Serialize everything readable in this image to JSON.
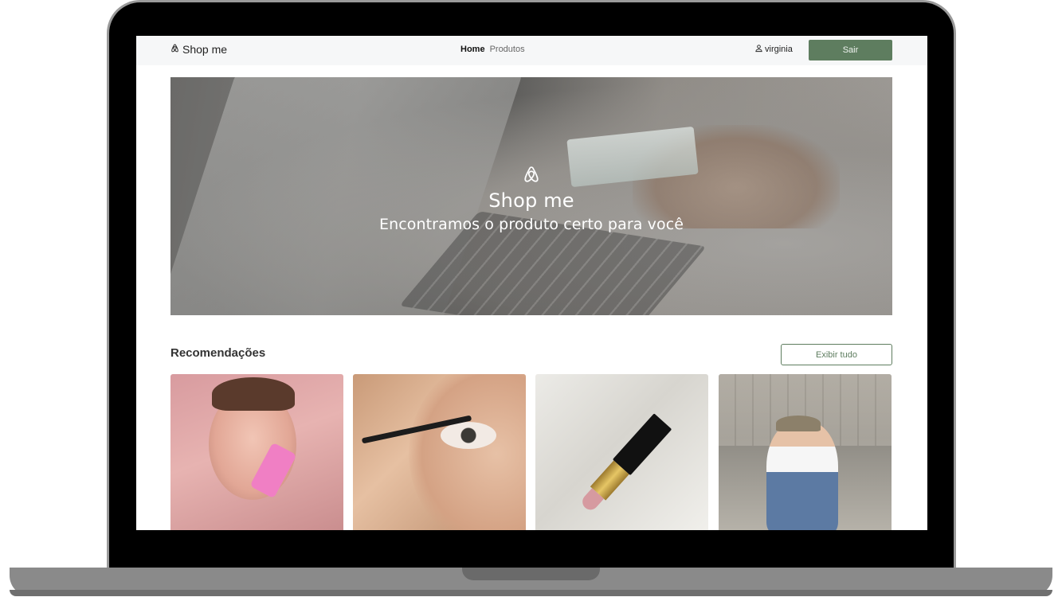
{
  "navbar": {
    "brand": "Shop me",
    "brand_icon": "airbnb-logo-icon",
    "links": [
      {
        "label": "Home",
        "active": true
      },
      {
        "label": "Produtos",
        "active": false
      }
    ],
    "user_icon": "user-icon",
    "username": "virginia",
    "logout_label": "Sair"
  },
  "hero": {
    "logo_icon": "airbnb-logo-icon",
    "title": "Shop me",
    "subtitle": "Encontramos o produto certo para você"
  },
  "recommendations": {
    "title": "Recomendações",
    "view_all_label": "Exibir tudo",
    "items": [
      {
        "image": "woman-holding-pink-tube-photo"
      },
      {
        "image": "applying-mascara-photo"
      },
      {
        "image": "lipstick-on-satin-photo"
      },
      {
        "image": "woman-denim-jacket-photo"
      }
    ]
  },
  "colors": {
    "accent": "#5e7d5f",
    "navbar_bg": "#f6f7f8",
    "frame": "#000000"
  }
}
